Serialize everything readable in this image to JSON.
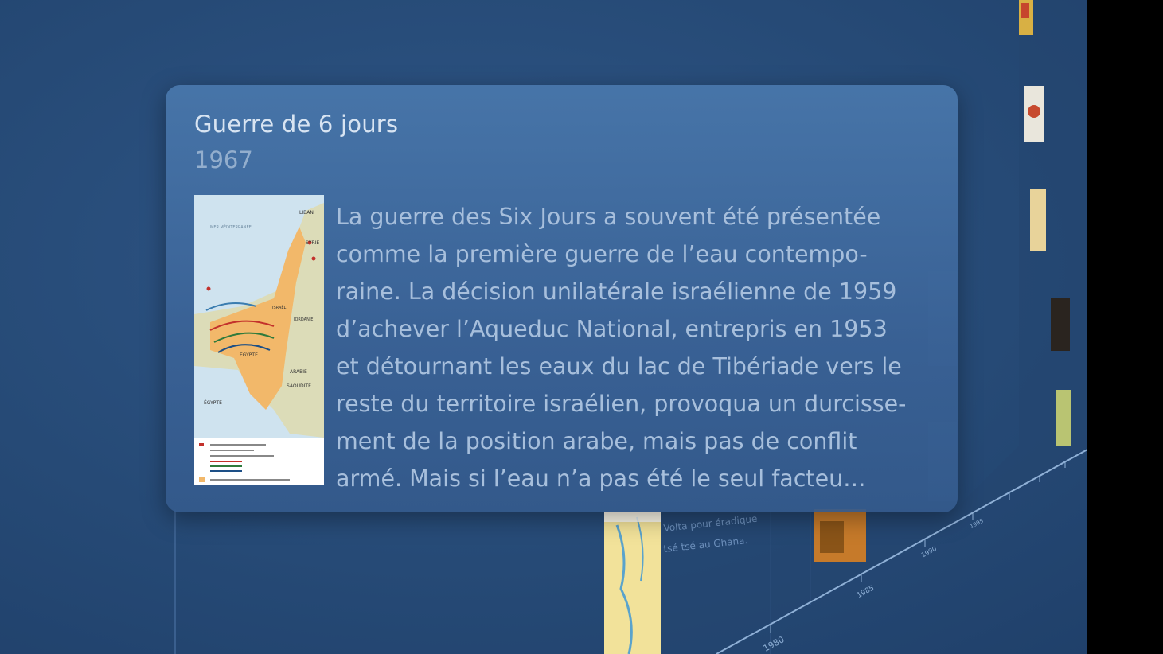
{
  "event": {
    "title": "Guerre de 6 jours",
    "year": "1967",
    "description_lines": [
      "La guerre des Six Jours a souvent été présentée",
      "comme la première guerre de l’eau contempo-",
      "raine. La décision unilatérale israélienne de 1959",
      "d’achever l’Aqueduc National, entrepris en 1953",
      "et détournant les eaux du lac de Tibériade vers le",
      "reste du territoire israélien, provoqua un durcisse-",
      "ment de la position arabe, mais pas de conflit",
      "armé.  Mais si l’eau n’a pas été le seul facteu…"
    ],
    "map_labels": {
      "sea": "MER MÉDITERRANÉE",
      "liban": "LIBAN",
      "syrie": "SYRIE",
      "israel": "ISRAËL",
      "jordanie": "JORDANIE",
      "egypte": "ÉGYPTE",
      "arabie": "ARABIE",
      "saoudite": "SAOUDITE",
      "egypte2": "ÉGYPTE"
    }
  },
  "timeline": {
    "year_labels": [
      "1980",
      "1985",
      "1990",
      "1995"
    ],
    "snippet_1": "Volta pour éradique",
    "snippet_2": "tsé tsé au Ghana."
  },
  "colors": {
    "background": "#264a76",
    "card": "#4876aa",
    "title_text": "#d8e4f2",
    "year_text": "#93aecd",
    "body_text": "#a7bfdc"
  }
}
